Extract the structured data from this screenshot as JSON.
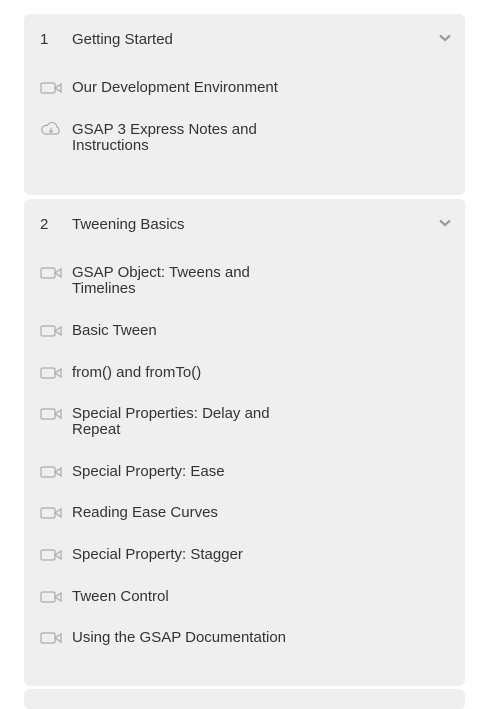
{
  "sections": [
    {
      "number": "1",
      "title": "Getting Started",
      "lessons": [
        {
          "label": "Our Development Environment",
          "icon": "video-icon"
        },
        {
          "label": "GSAP 3 Express Notes and Instructions",
          "icon": "cloud-download-icon"
        }
      ]
    },
    {
      "number": "2",
      "title": "Tweening Basics",
      "lessons": [
        {
          "label": "GSAP Object: Tweens and Timelines",
          "icon": "video-icon"
        },
        {
          "label": "Basic Tween",
          "icon": "video-icon"
        },
        {
          "label": "from() and fromTo()",
          "icon": "video-icon"
        },
        {
          "label": "Special Properties: Delay and Repeat",
          "icon": "video-icon"
        },
        {
          "label": "Special Property: Ease",
          "icon": "video-icon"
        },
        {
          "label": "Reading Ease Curves",
          "icon": "video-icon"
        },
        {
          "label": "Special Property: Stagger",
          "icon": "video-icon"
        },
        {
          "label": "Tween Control",
          "icon": "video-icon"
        },
        {
          "label": "Using the GSAP Documentation",
          "icon": "video-icon"
        }
      ]
    }
  ],
  "colors": {
    "panel": "#efefef",
    "text": "#333333",
    "icon": "#aaaaaa"
  }
}
